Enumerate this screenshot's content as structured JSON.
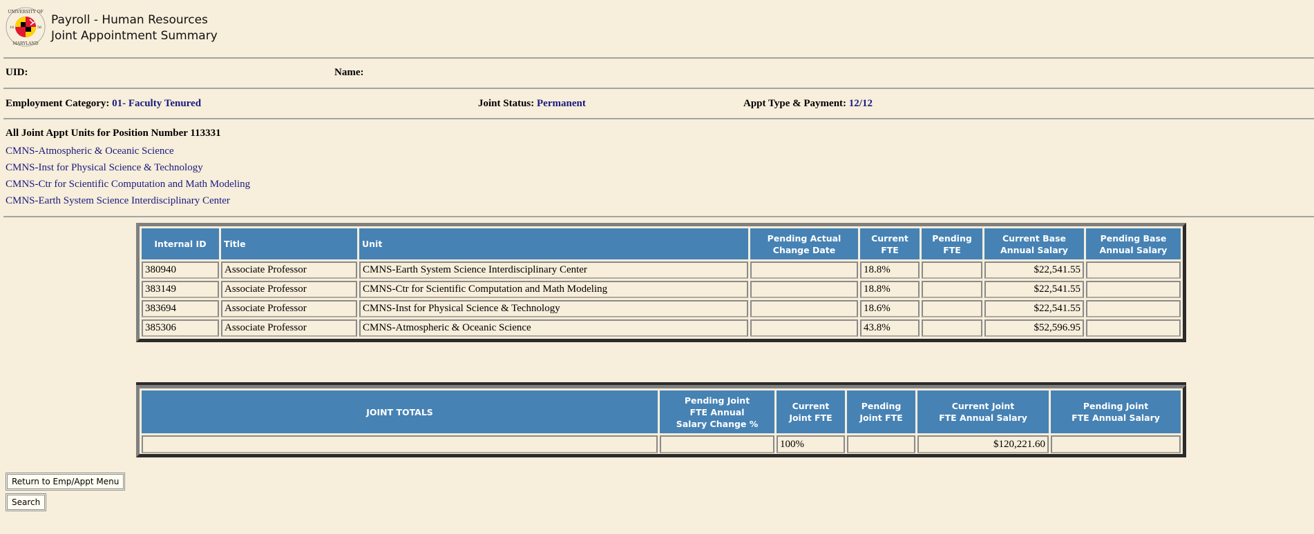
{
  "header": {
    "logo_label": "University of Maryland seal",
    "app_name": "Payroll - Human Resources",
    "page_title": "Joint Appointment Summary"
  },
  "employee": {
    "uid_label": "UID:",
    "uid_value": "",
    "name_label": "Name:",
    "name_value": "",
    "employment_category_label": "Employment Category:",
    "employment_category_value": "01- Faculty Tenured",
    "joint_status_label": "Joint Status:",
    "joint_status_value": "Permanent",
    "appt_type_label": "Appt Type & Payment:",
    "appt_type_value": "12/12"
  },
  "units": {
    "heading": "All Joint Appt Units for Position Number 113331",
    "links": [
      "CMNS-Atmospheric & Oceanic Science",
      "CMNS-Inst for Physical Science & Technology",
      "CMNS-Ctr for Scientific Computation and Math Modeling",
      "CMNS-Earth System Science Interdisciplinary Center"
    ]
  },
  "appointments_table": {
    "columns": [
      "Internal ID",
      "Title",
      "Unit",
      "Pending Actual\nChange Date",
      "Current\nFTE",
      "Pending\nFTE",
      "Current Base\nAnnual Salary",
      "Pending Base\nAnnual Salary"
    ],
    "rows": [
      {
        "internal_id": "380940",
        "title": "Associate Professor",
        "unit": "CMNS-Earth System Science Interdisciplinary Center",
        "pending_change_date": "",
        "current_fte": "18.8%",
        "pending_fte": "",
        "current_base_salary": "$22,541.55",
        "pending_base_salary": ""
      },
      {
        "internal_id": "383149",
        "title": "Associate Professor",
        "unit": "CMNS-Ctr for Scientific Computation and Math Modeling",
        "pending_change_date": "",
        "current_fte": "18.8%",
        "pending_fte": "",
        "current_base_salary": "$22,541.55",
        "pending_base_salary": ""
      },
      {
        "internal_id": "383694",
        "title": "Associate Professor",
        "unit": "CMNS-Inst for Physical Science & Technology",
        "pending_change_date": "",
        "current_fte": "18.6%",
        "pending_fte": "",
        "current_base_salary": "$22,541.55",
        "pending_base_salary": ""
      },
      {
        "internal_id": "385306",
        "title": "Associate Professor",
        "unit": "CMNS-Atmospheric & Oceanic Science",
        "pending_change_date": "",
        "current_fte": "43.8%",
        "pending_fte": "",
        "current_base_salary": "$52,596.95",
        "pending_base_salary": ""
      }
    ]
  },
  "totals_table": {
    "columns": [
      "JOINT TOTALS",
      "Pending Joint\nFTE Annual\nSalary Change %",
      "Current\nJoint FTE",
      "Pending\nJoint FTE",
      "Current Joint\nFTE Annual Salary",
      "Pending Joint\nFTE Annual Salary"
    ],
    "row": {
      "label": "",
      "pending_salary_change_pct": "",
      "current_joint_fte": "100%",
      "pending_joint_fte": "",
      "current_joint_salary": "$120,221.60",
      "pending_joint_salary": ""
    }
  },
  "buttons": {
    "return_label": "Return to Emp/Appt Menu",
    "search_label": "Search"
  }
}
